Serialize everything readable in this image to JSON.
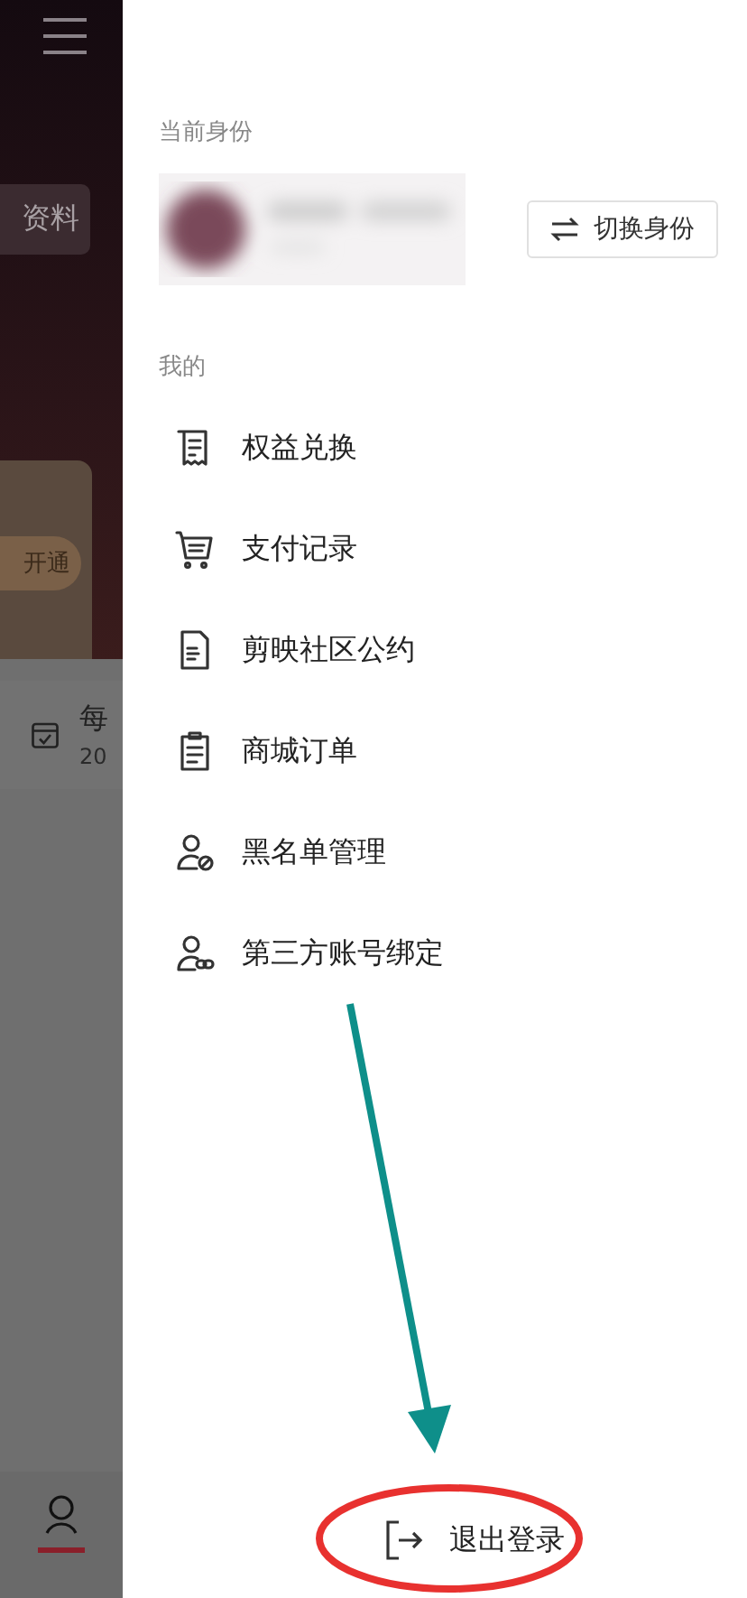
{
  "background": {
    "profile_button": "资料",
    "vip_button": "开通",
    "task_title": "每",
    "task_date": "20",
    "tab_selected": true
  },
  "drawer": {
    "current_label": "当前身份",
    "switch_button": "切换身份",
    "section_label": "我的",
    "menu": [
      {
        "kind": "receipt",
        "label": "权益兑换"
      },
      {
        "kind": "cart",
        "label": "支付记录"
      },
      {
        "kind": "document",
        "label": "剪映社区公约"
      },
      {
        "kind": "clipboard",
        "label": "商城订单"
      },
      {
        "kind": "block-user",
        "label": "黑名单管理"
      },
      {
        "kind": "link-user",
        "label": "第三方账号绑定"
      }
    ],
    "logout": "退出登录"
  }
}
